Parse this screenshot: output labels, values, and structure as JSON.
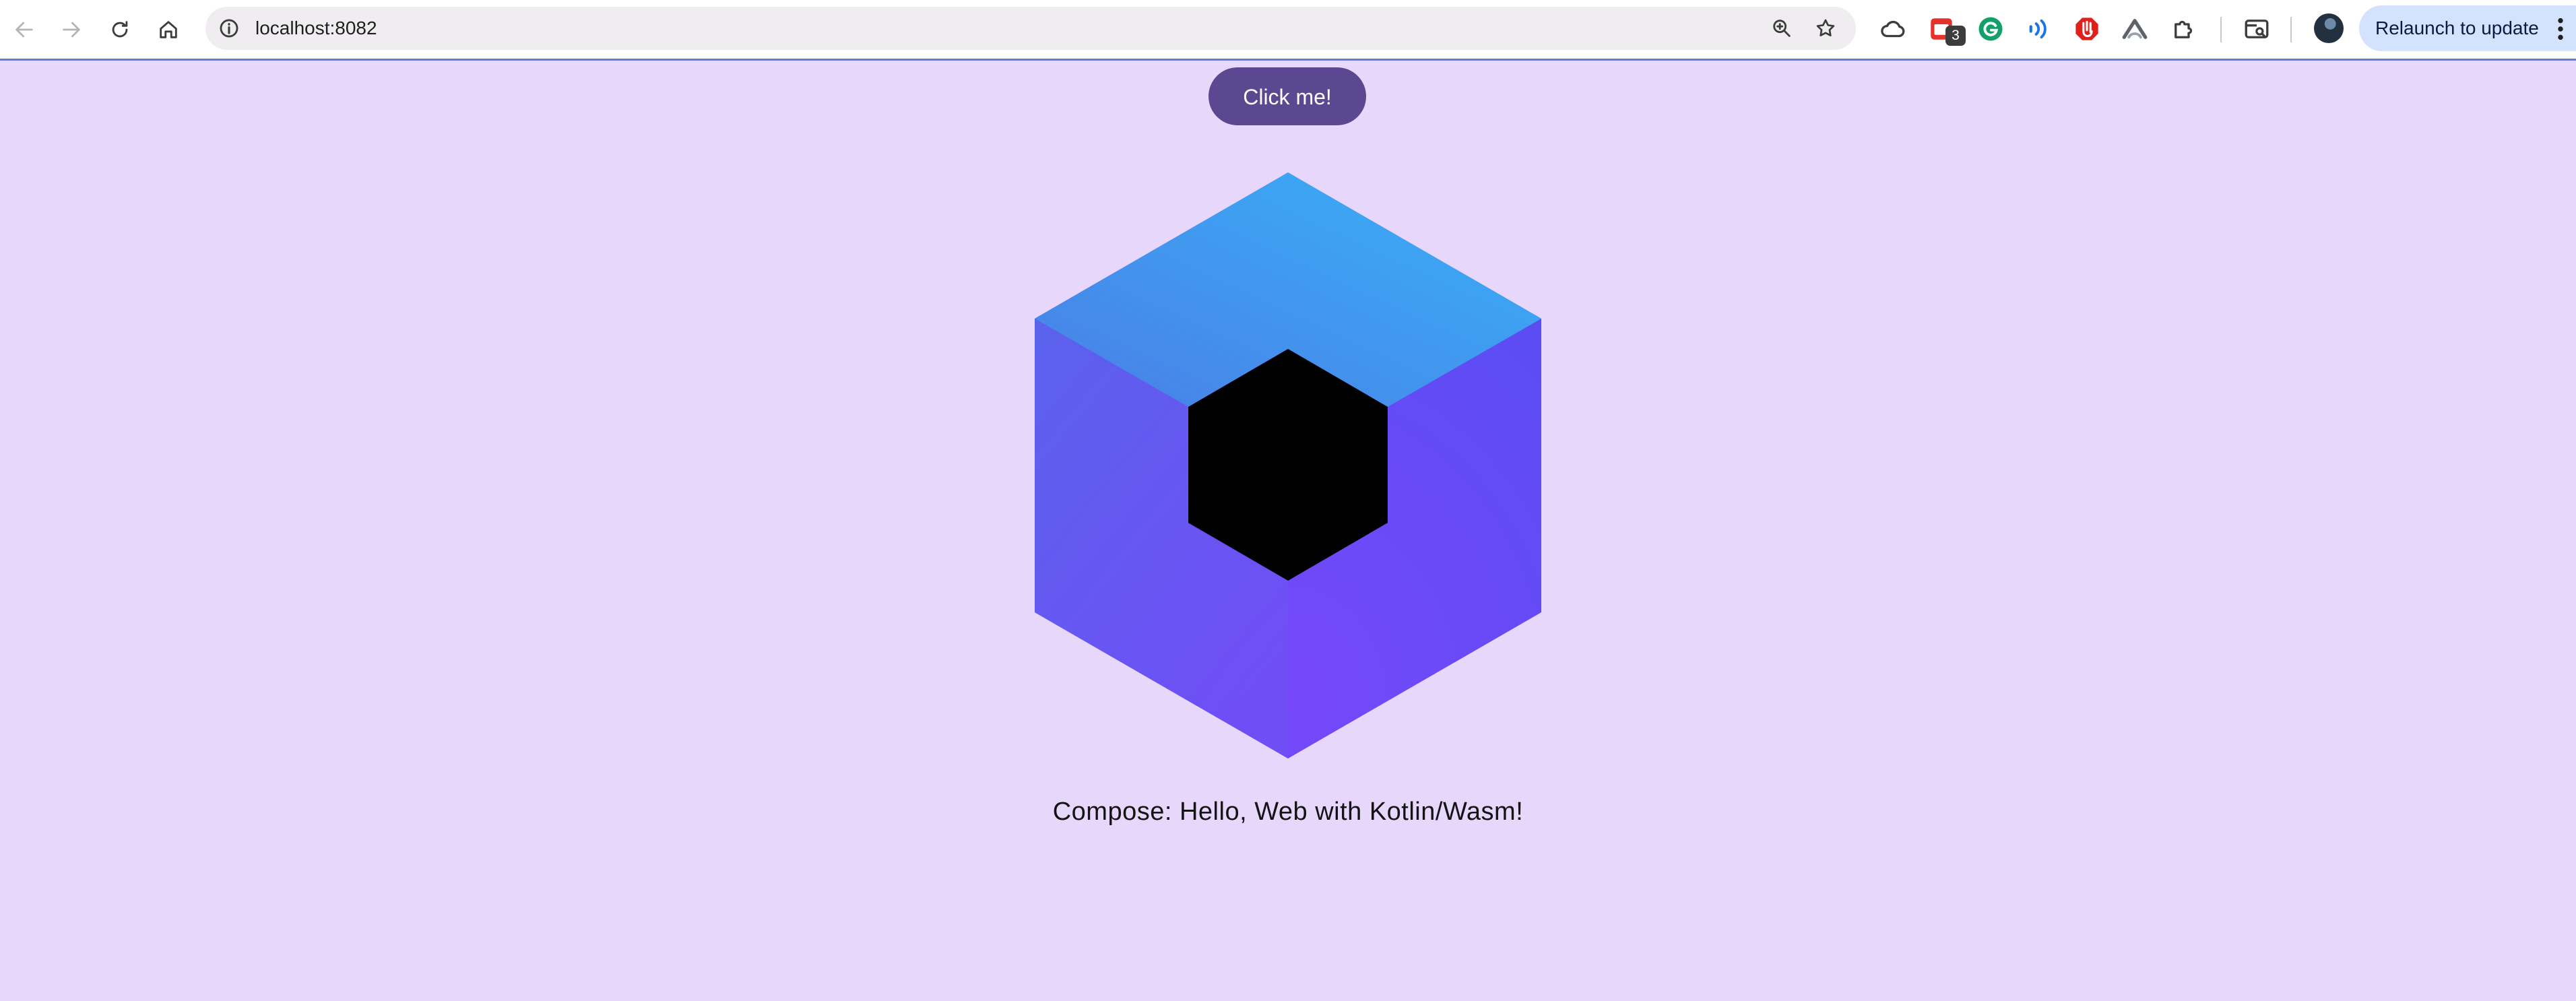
{
  "browser": {
    "url": "localhost:8082",
    "extension_badge_count": "3",
    "relaunch_label": "Relaunch to update",
    "icons": [
      "back-arrow-icon",
      "forward-arrow-icon",
      "reload-icon",
      "home-icon",
      "site-info-icon",
      "zoom-icon",
      "star-icon",
      "cloud-icon",
      "calendar-extension-icon",
      "grammarly-icon",
      "wave-extension-icon",
      "block-extension-icon",
      "arc-extension-icon",
      "puzzle-icon",
      "tab-search-icon",
      "profile-avatar",
      "more-vert-icon"
    ]
  },
  "page": {
    "button_label": "Click me!",
    "greeting": "Compose: Hello, Web with Kotlin/Wasm!",
    "colors": {
      "background": "#e6d7fb",
      "button": "#5c4891",
      "logo_top_light": "#3aaaf6",
      "logo_side": "#5f4cf3",
      "logo_center": "#000000"
    }
  }
}
